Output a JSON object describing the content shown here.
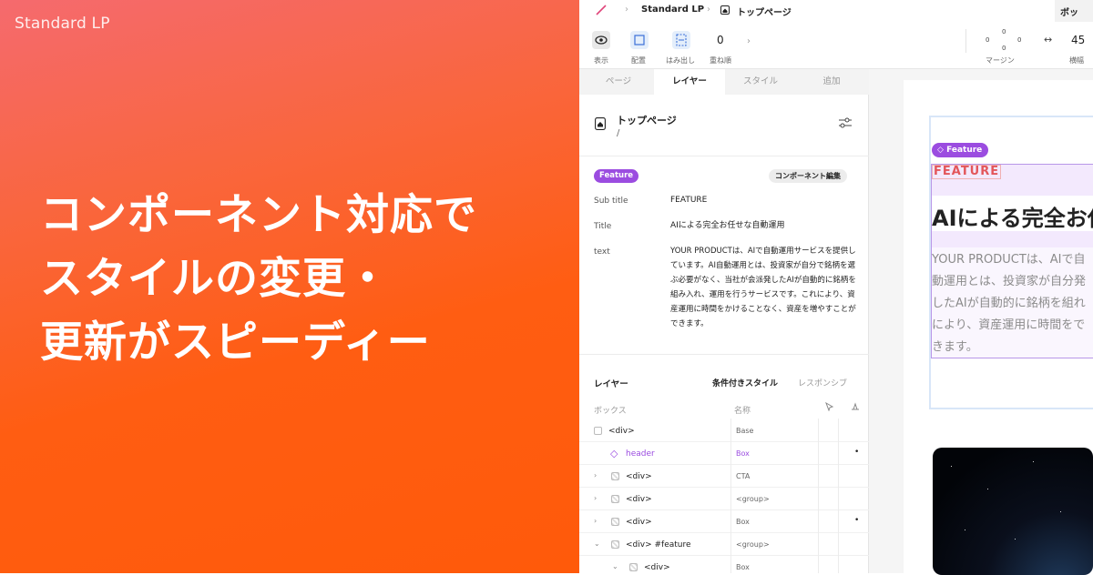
{
  "brand": "Standard LP",
  "headline": [
    "コンポーネント対応で",
    "スタイルの変更・",
    "更新がスピーディー"
  ],
  "app": {
    "breadcrumbs": [
      "Standard LP",
      "トップページ"
    ],
    "right_tab": "ボッ",
    "toolbar": {
      "tools": [
        "表示",
        "配置",
        "はみ出し",
        "重ね順"
      ],
      "stack_order": "0",
      "margin_label": "マージン",
      "margin_values": [
        "0",
        "0",
        "0",
        "0"
      ],
      "width_label": "横幅",
      "width_value": "45"
    },
    "tabs": [
      "ページ",
      "レイヤー",
      "スタイル",
      "追加"
    ],
    "page": {
      "title": "トップページ",
      "path": "/"
    },
    "component": {
      "pill": "Feature",
      "edit_button": "コンポーネント編集",
      "props": [
        {
          "key": "Sub title",
          "value": "FEATURE"
        },
        {
          "key": "Title",
          "value": "AIによる完全お任せな自動運用"
        },
        {
          "key": "text",
          "value": "YOUR PRODUCTは、AIで自動運用サービスを提供しています。AI自動運用とは、投資家が自分で銘柄を選ぶ必要がなく、当社が会派発したAIが自動的に銘柄を組み入れ、運用を行うサービスです。これにより、資産運用に時間をかけることなく、資産を増やすことができます。"
        }
      ]
    },
    "layers": {
      "title": "レイヤー",
      "cond_style": "条件付きスタイル",
      "responsive": "レスポンシブ",
      "col_box": "ボックス",
      "col_name": "名称",
      "rows": [
        {
          "name": "<div>",
          "value": "Base",
          "dot": ""
        },
        {
          "name": "header",
          "value": "Box",
          "dot": "•"
        },
        {
          "name": "<div>",
          "value": "CTA",
          "dot": ""
        },
        {
          "name": "<div>",
          "value": "<group>",
          "dot": ""
        },
        {
          "name": "<div>",
          "value": "Box",
          "dot": "•"
        },
        {
          "name": "<div> #feature",
          "value": "<group>",
          "dot": ""
        },
        {
          "name": "<div>",
          "value": "Box",
          "dot": ""
        }
      ]
    },
    "canvas": {
      "tag": "Feature",
      "subtitle": "FEATURE",
      "title": "AIによる完全お任",
      "text": "YOUR PRODUCTは、AIで自動運用とは、投資家が自分発したAIが自動的に銘柄を組れにより、資産運用に時間をできます。"
    },
    "colors": {
      "accent": "#9b4ce0",
      "promo_start": "#f56a6e",
      "promo_end": "#ff5a0a"
    }
  }
}
